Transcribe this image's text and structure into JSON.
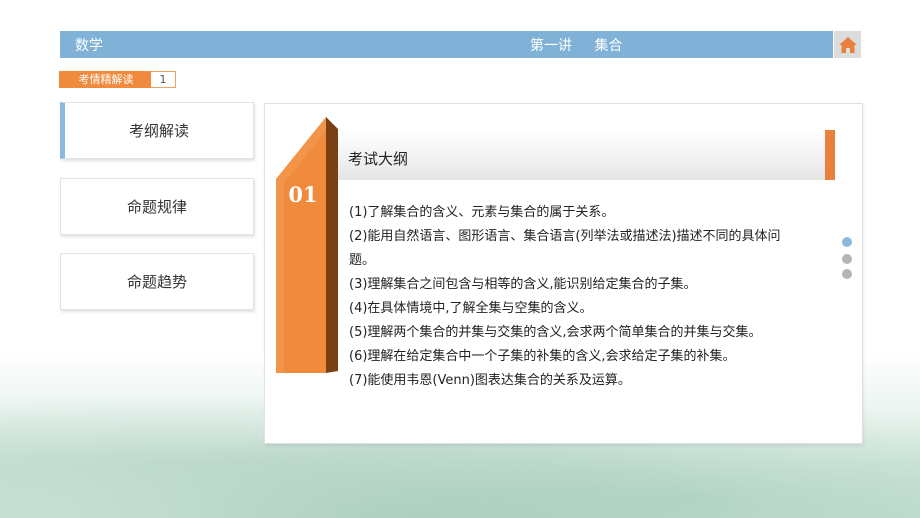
{
  "header": {
    "subject": "数学",
    "lecture": "第一讲 集合",
    "home_icon": "home-icon",
    "bar_color": "#7fb2d6"
  },
  "section_tag": {
    "label": "考情精解读",
    "number": "1",
    "color": "#f08a3c"
  },
  "menu": {
    "items": [
      {
        "label": "考纲解读",
        "active": true
      },
      {
        "label": "命题规律",
        "active": false
      },
      {
        "label": "命题趋势",
        "active": false
      }
    ]
  },
  "panel": {
    "number": "01",
    "title": "考试大纲",
    "accent_color": "#e9813d",
    "items": [
      "(1)了解集合的含义、元素与集合的属于关系。",
      "(2)能用自然语言、图形语言、集合语言(列举法或描述法)描述不同的具体问题。",
      "(3)理解集合之间包含与相等的含义,能识别给定集合的子集。",
      "(4)在具体情境中,了解全集与空集的含义。",
      "(5)理解两个集合的并集与交集的含义,会求两个简单集合的并集与交集。",
      "(6)理解在给定集合中一个子集的补集的含义,会求给定子集的补集。",
      "(7)能使用韦恩(Venn)图表达集合的关系及运算。"
    ]
  },
  "pager": {
    "pages": 3,
    "current": 1,
    "active_color": "#8db9dc",
    "inactive_color": "#b5b5b5"
  }
}
